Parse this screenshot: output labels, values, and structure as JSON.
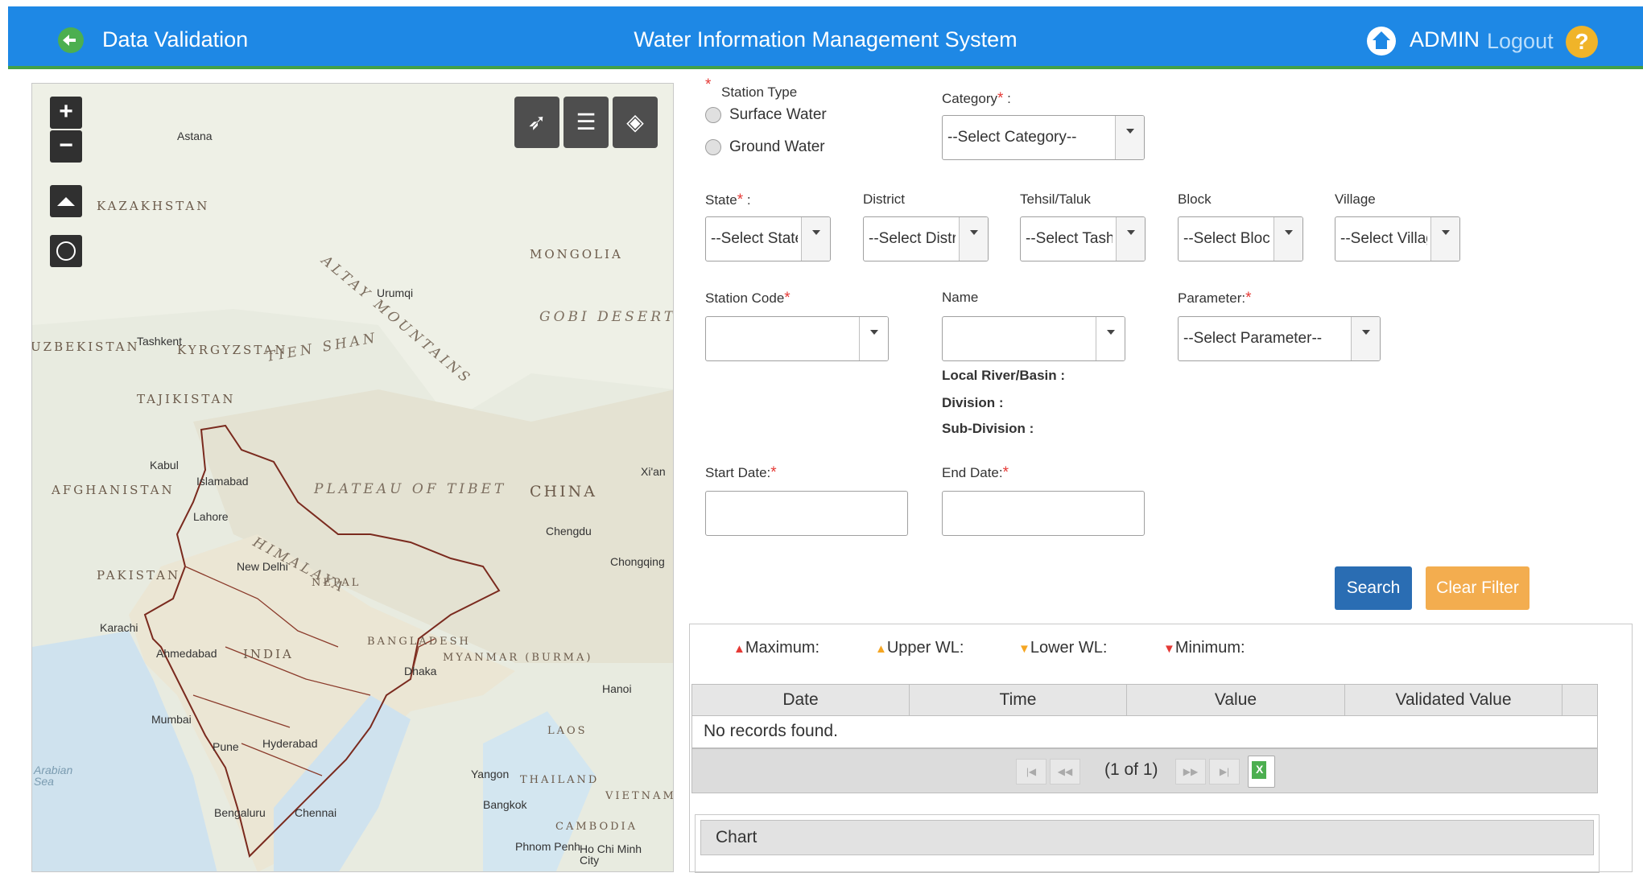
{
  "header": {
    "section_title": "Data Validation",
    "app_title": "Water Information Management System",
    "user": "ADMIN",
    "logout_label": "Logout",
    "help_label": "?"
  },
  "map": {
    "zoom_in": "+",
    "zoom_out": "−",
    "countries": [
      "KAZAKHSTAN",
      "MONGOLIA",
      "UZBEKISTAN",
      "KYRGYZSTAN",
      "TAJIKISTAN",
      "AFGHANISTAN",
      "CHINA",
      "PAKISTAN",
      "NEPAL",
      "INDIA",
      "BANGLADESH",
      "MYANMAR (BURMA)",
      "LAOS",
      "THAILAND",
      "VIETNAM",
      "CAMBODIA"
    ],
    "regions": [
      "ALTAY MOUNTAINS",
      "GOBI DESERT",
      "TIEN SHAN",
      "PLATEAU OF TIBET",
      "HIMALAYA"
    ],
    "cities": [
      "Astana",
      "Urumqi",
      "Tashkent",
      "Kabul",
      "Islamabad",
      "Lahore",
      "New Delhi",
      "Karachi",
      "Ahmedabad",
      "Mumbai",
      "Pune",
      "Hyderabad",
      "Bengaluru",
      "Chennai",
      "Dhaka",
      "Chengdu",
      "Chongqing",
      "Xi'an",
      "Hanoi",
      "Yangon",
      "Bangkok",
      "Phnom Penh",
      "Ho Chi Minh City"
    ],
    "sea_label": "Arabian Sea"
  },
  "form": {
    "station_type_label": "Station Type",
    "surface_water": "Surface Water",
    "ground_water": "Ground Water",
    "category_label": "Category",
    "category_placeholder": "--Select Category--",
    "state_label": "State",
    "state_placeholder": "--Select State-",
    "district_label": "District",
    "district_placeholder": "--Select Distric",
    "tehsil_label": "Tehsil/Taluk",
    "tehsil_placeholder": "--Select Tashil",
    "block_label": "Block",
    "block_placeholder": "--Select Block",
    "village_label": "Village",
    "village_placeholder": "--Select Villag",
    "station_code_label": "Station Code",
    "name_label": "Name",
    "parameter_label": "Parameter:",
    "parameter_placeholder": "--Select Parameter--",
    "local_river_label": "Local River/Basin :",
    "division_label": "Division :",
    "subdivision_label": "Sub-Division :",
    "start_date_label": "Start Date:",
    "end_date_label": "End Date:",
    "colon": ":",
    "required_mark": "*",
    "search_label": "Search",
    "clear_label": "Clear Filter"
  },
  "results": {
    "legend": [
      {
        "label": "Maximum:",
        "marker": "▲",
        "color": "#e53935"
      },
      {
        "label": "Upper WL:",
        "marker": "▲",
        "color": "#f5a623"
      },
      {
        "label": "Lower WL:",
        "marker": "▼",
        "color": "#f5a623"
      },
      {
        "label": "Minimum:",
        "marker": "▼",
        "color": "#e53935"
      }
    ],
    "columns": [
      "Date",
      "Time",
      "Value",
      "Validated Value"
    ],
    "empty_message": "No records found.",
    "page_info": "(1 of 1)",
    "chart_title": "Chart"
  }
}
